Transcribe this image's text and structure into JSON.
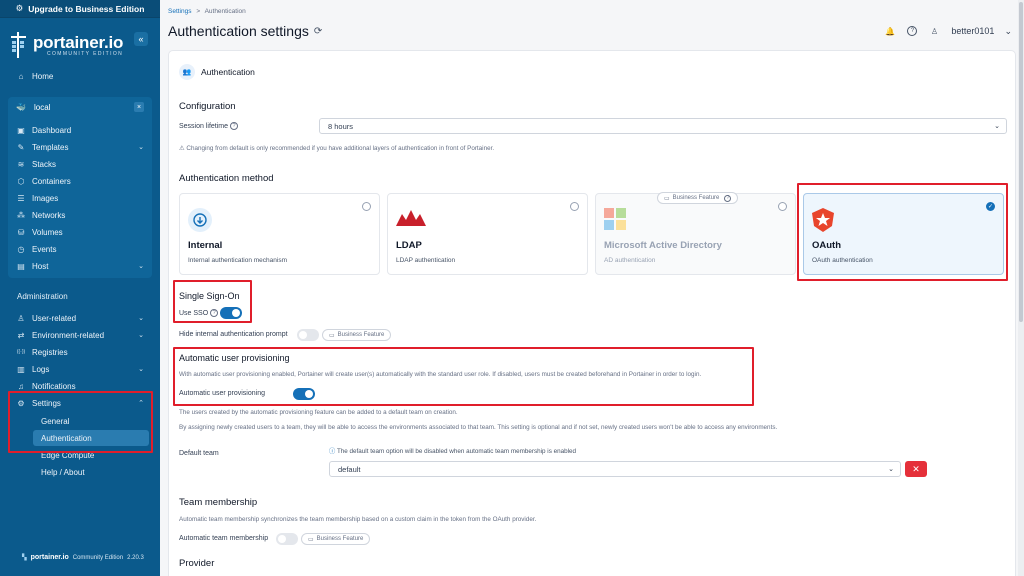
{
  "sidebar": {
    "upgrade_label": "Upgrade to Business Edition",
    "logo_name": "portainer.io",
    "logo_sub": "COMMUNITY EDITION",
    "collapse_icon": "«",
    "home": "Home",
    "environment": {
      "name": "local",
      "items": [
        {
          "label": "Dashboard",
          "icon": "dashboard-icon",
          "glyph": "▣"
        },
        {
          "label": "Templates",
          "icon": "templates-icon",
          "glyph": "✎",
          "chevron": true
        },
        {
          "label": "Stacks",
          "icon": "stacks-icon",
          "glyph": "≋"
        },
        {
          "label": "Containers",
          "icon": "containers-icon",
          "glyph": "⬡"
        },
        {
          "label": "Images",
          "icon": "images-icon",
          "glyph": "☰"
        },
        {
          "label": "Networks",
          "icon": "networks-icon",
          "glyph": "⁂"
        },
        {
          "label": "Volumes",
          "icon": "volumes-icon",
          "glyph": "⛁"
        },
        {
          "label": "Events",
          "icon": "events-icon",
          "glyph": "◷"
        },
        {
          "label": "Host",
          "icon": "host-icon",
          "glyph": "▤",
          "chevron": true
        }
      ]
    },
    "admin_label": "Administration",
    "admin_items": [
      {
        "label": "User-related",
        "icon": "user-icon",
        "glyph": "♙",
        "chevron": true
      },
      {
        "label": "Environment-related",
        "icon": "environment-icon",
        "glyph": "⇄",
        "chevron": true
      },
      {
        "label": "Registries",
        "icon": "registries-icon",
        "glyph": "((·))"
      },
      {
        "label": "Logs",
        "icon": "logs-icon",
        "glyph": "▥",
        "chevron": true
      },
      {
        "label": "Notifications",
        "icon": "bell-icon",
        "glyph": "♫"
      },
      {
        "label": "Settings",
        "icon": "gear-icon",
        "glyph": "⚙",
        "chevron": true,
        "expanded": true
      }
    ],
    "settings_sub": [
      "General",
      "Authentication",
      "Edge Compute",
      "Help / About"
    ],
    "footer_name": "portainer.io",
    "footer_edition": "Community Edition",
    "footer_version": "2.20.3"
  },
  "header": {
    "breadcrumb_root": "Settings",
    "breadcrumb_sep": ">",
    "breadcrumb_current": "Authentication",
    "title": "Authentication settings",
    "refresh_icon": "⟳",
    "username": "better0101",
    "user_chevron": "⌄"
  },
  "panel": {
    "head_title": "Authentication",
    "configuration": "Configuration",
    "session_label": "Session lifetime",
    "session_value": "8 hours",
    "session_note": "Changing from default is only recommended if you have additional layers of authentication in front of Portainer.",
    "auth_method": "Authentication method",
    "business_feature": "Business Feature",
    "methods": [
      {
        "title": "Internal",
        "desc": "Internal authentication mechanism"
      },
      {
        "title": "LDAP",
        "desc": "LDAP authentication"
      },
      {
        "title": "Microsoft Active Directory",
        "desc": "AD authentication"
      },
      {
        "title": "OAuth",
        "desc": "OAuth authentication"
      }
    ],
    "sso_title": "Single Sign-On",
    "use_sso": "Use SSO",
    "hide_prompt": "Hide internal authentication prompt",
    "auto_prov_title": "Automatic user provisioning",
    "auto_prov_desc": "With automatic user provisioning enabled, Portainer will create user(s) automatically with the standard user role. If disabled, users must be created beforehand in Portainer in order to login.",
    "auto_prov_label": "Automatic user provisioning",
    "team_note1": "The users created by the automatic provisioning feature can be added to a default team on creation.",
    "team_note2": "By assigning newly created users to a team, they will be able to access the environments associated to that team. This setting is optional and if not set, newly created users won't be able to access any environments.",
    "default_team_label": "Default team",
    "default_team_info": "The default team option will be disabled when automatic team membership is enabled",
    "default_team_value": "default",
    "delete_icon": "✕",
    "team_membership": "Team membership",
    "team_membership_desc": "Automatic team membership synchronizes the team membership based on a custom claim in the token from the OAuth provider.",
    "auto_team_label": "Automatic team membership",
    "provider": "Provider"
  }
}
